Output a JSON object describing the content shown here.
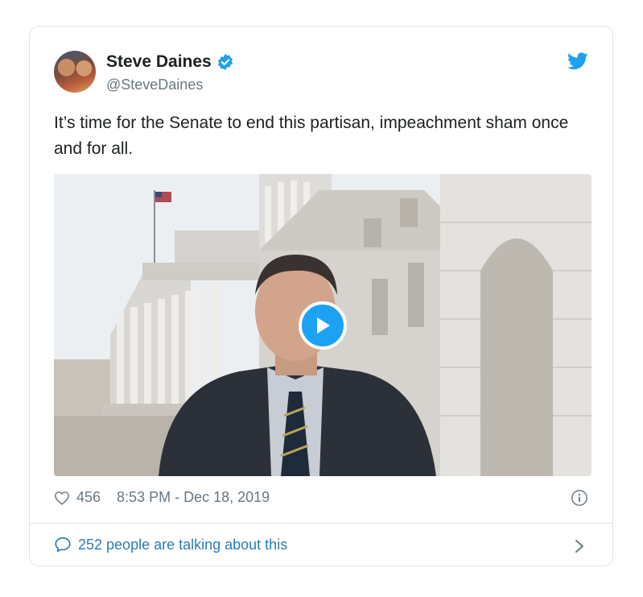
{
  "author": {
    "name": "Steve Daines",
    "handle": "@SteveDaines",
    "verified": true
  },
  "tweet": {
    "text": "It’s time for the Senate to end this partisan, impeachment sham once and for all.",
    "media_type": "video"
  },
  "stats": {
    "likes": "456",
    "timestamp": "8:53 PM - Dec 18, 2019"
  },
  "footer": {
    "talking_label": "252 people are talking about this"
  },
  "icons": {
    "verified": "verified-badge-icon",
    "brand": "twitter-bird-icon",
    "play": "play-icon",
    "like": "heart-icon",
    "info": "info-icon",
    "reply": "speech-bubble-icon",
    "more": "chevron-right-icon"
  },
  "colors": {
    "accent": "#1da1f2",
    "link": "#2b7bb9",
    "muted": "#697882",
    "text": "#1c2022",
    "border": "#dfe3e7"
  }
}
